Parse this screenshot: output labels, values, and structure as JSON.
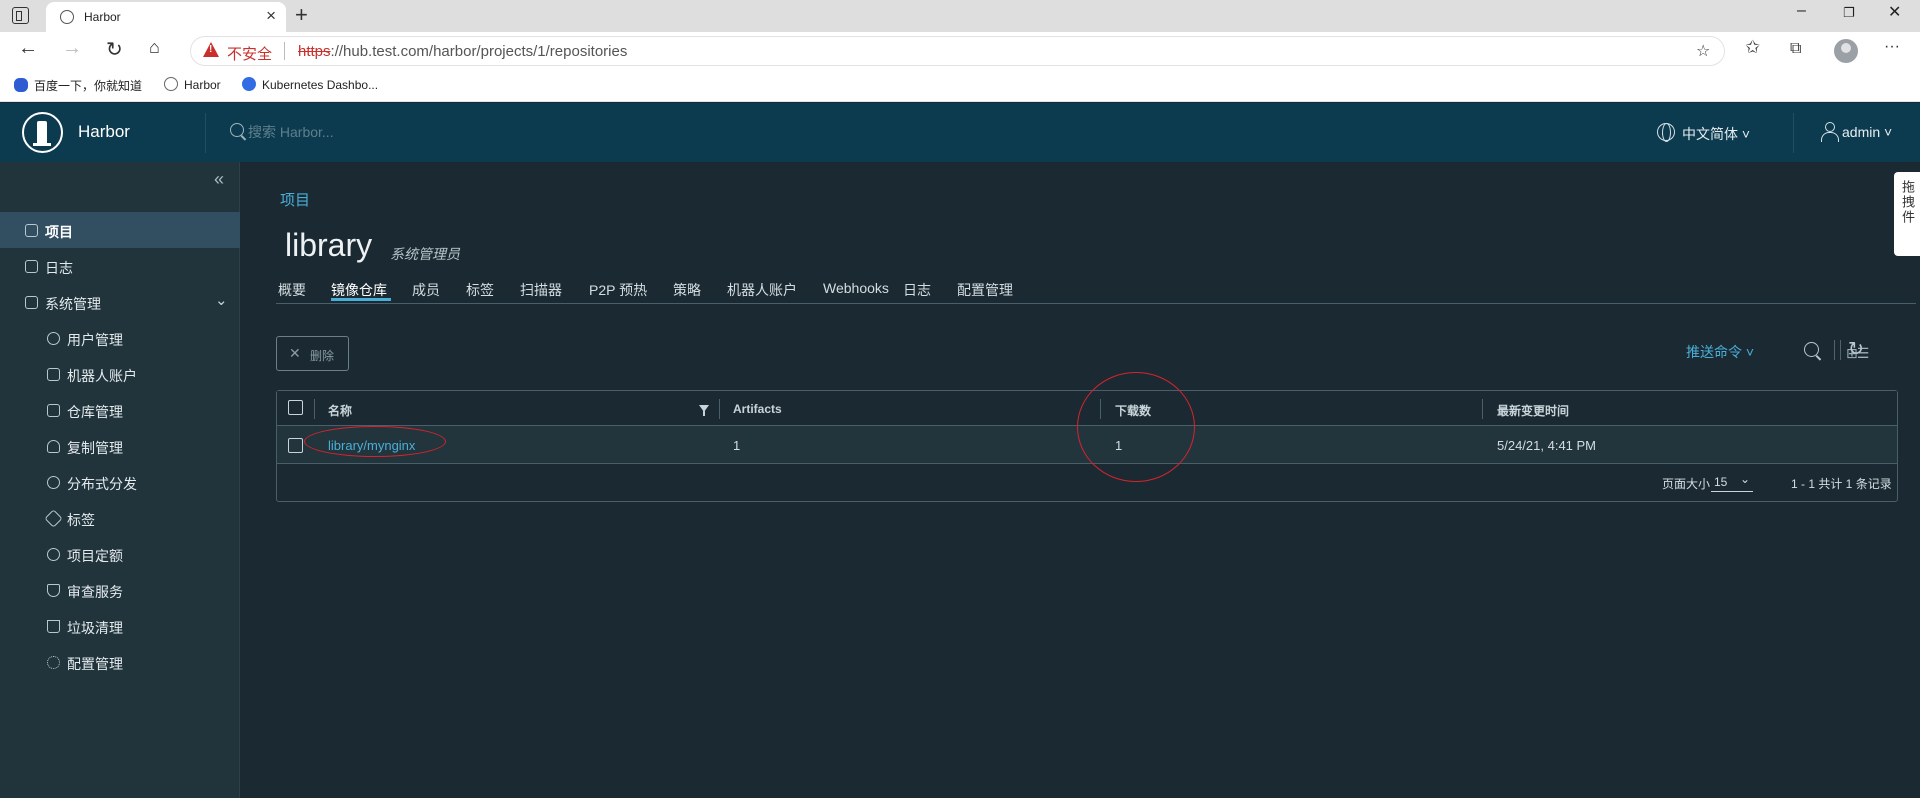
{
  "browser": {
    "tab_title": "Harbor",
    "insecure_label": "不安全",
    "url_scheme": "https",
    "url_rest": "://hub.test.com/harbor/projects/1/repositories",
    "bookmarks": [
      "百度一下，你就知道",
      "Harbor",
      "Kubernetes Dashbo..."
    ]
  },
  "header": {
    "app_name": "Harbor",
    "search_placeholder": "搜索 Harbor...",
    "language": "中文简体 ˅",
    "user": "admin ˅"
  },
  "sidebar": {
    "items": [
      {
        "label": "项目",
        "icon": "projects-icon",
        "active": true
      },
      {
        "label": "日志",
        "icon": "logs-icon"
      },
      {
        "label": "系统管理",
        "icon": "admin-icon"
      },
      {
        "label": "用户管理",
        "icon": "users-icon"
      },
      {
        "label": "机器人账户",
        "icon": "robot-icon"
      },
      {
        "label": "仓库管理",
        "icon": "registry-icon"
      },
      {
        "label": "复制管理",
        "icon": "replication-icon"
      },
      {
        "label": "分布式分发",
        "icon": "distribution-icon"
      },
      {
        "label": "标签",
        "icon": "tag-icon"
      },
      {
        "label": "项目定额",
        "icon": "quota-icon"
      },
      {
        "label": "审查服务",
        "icon": "shield-icon"
      },
      {
        "label": "垃圾清理",
        "icon": "trash-icon"
      },
      {
        "label": "配置管理",
        "icon": "gear-icon"
      }
    ]
  },
  "main": {
    "breadcrumb": "项目",
    "project_name": "library",
    "project_role": "系统管理员",
    "tabs": [
      "概要",
      "镜像仓库",
      "成员",
      "标签",
      "扫描器",
      "P2P 预热",
      "策略",
      "机器人账户",
      "Webhooks",
      "日志",
      "配置管理"
    ],
    "active_tab": "镜像仓库",
    "delete_label": "删除",
    "push_command": "推送命令 ˅",
    "table": {
      "columns": [
        "名称",
        "Artifacts",
        "下载数",
        "最新变更时间"
      ],
      "rows": [
        {
          "name": "library/mynginx",
          "artifacts": "1",
          "pulls": "1",
          "updated": "5/24/21, 4:41 PM"
        }
      ],
      "page_size_label": "页面大小",
      "page_size": "15",
      "page_info": "1 - 1 共计 1 条记录"
    }
  },
  "side_tab": "拖拽件",
  "colors": {
    "accent": "#49afd9",
    "header": "#0c3b4f",
    "annotation": "#d9232d"
  }
}
